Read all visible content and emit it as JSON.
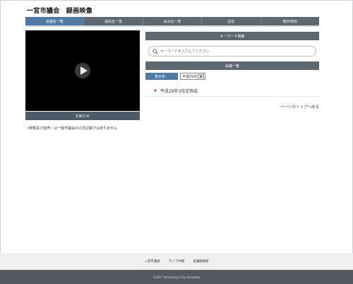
{
  "site": {
    "title": "一宮市議会　録画映像"
  },
  "tabs": [
    {
      "label": "会議名一覧"
    },
    {
      "label": "議員名一覧"
    },
    {
      "label": "会派名一覧"
    },
    {
      "label": "設定"
    },
    {
      "label": "動作環境"
    }
  ],
  "player": {
    "notice_label": "お知らせ",
    "disclaimer": "（映像及び音声）は一宮市議会の公式記録ではありません"
  },
  "keyword": {
    "header": "キーワード検索",
    "placeholder": "キーワードを入力してください"
  },
  "meetings": {
    "header": "会議一覧",
    "year_label": "表示年：",
    "year_value": "平成29年",
    "items": [
      {
        "label": "平成29年3月定例会"
      }
    ],
    "back_to_top": "ページのトップへ戻る"
  },
  "footer": {
    "links": [
      {
        "label": "一宮市議会"
      },
      {
        "label": "ライブ中継"
      },
      {
        "label": "会議録検索"
      }
    ],
    "copyright": "©2017 Ichinomiya City Assembly"
  },
  "colors": {
    "active_tab": "#4f7aa6",
    "nav_bar": "#5d6770",
    "session_arrow": "#c0392b"
  }
}
